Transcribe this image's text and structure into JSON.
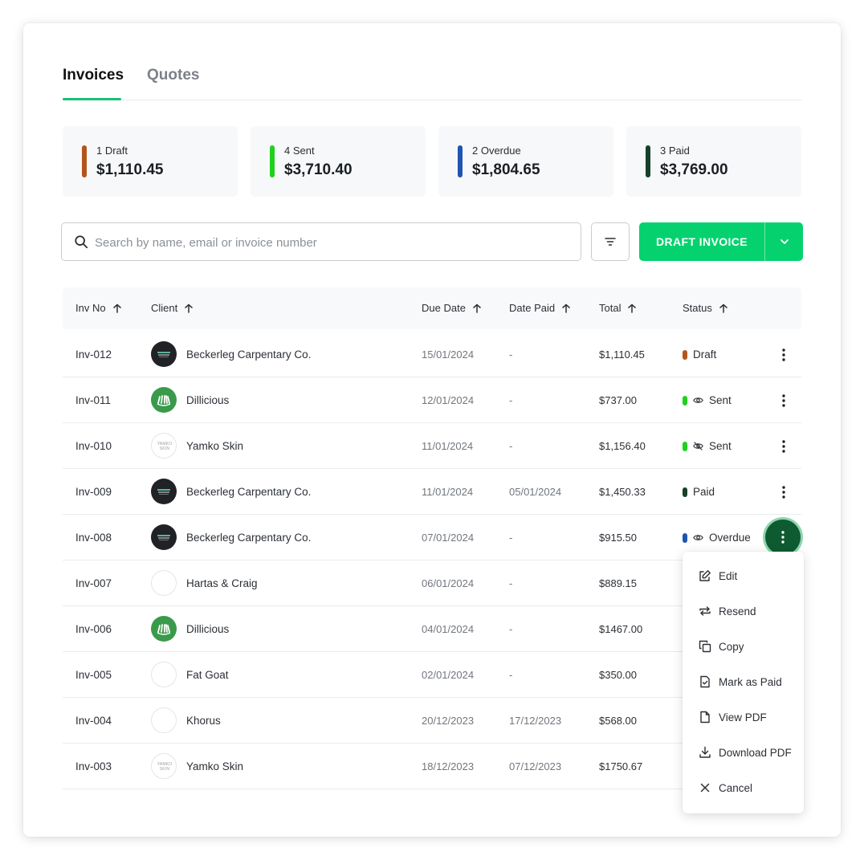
{
  "tabs": [
    {
      "label": "Invoices",
      "active": true
    },
    {
      "label": "Quotes",
      "active": false
    }
  ],
  "summary": [
    {
      "label": "1 Draft",
      "amount": "$1,110.45",
      "color": "#b4541a"
    },
    {
      "label": "4 Sent",
      "amount": "$3,710.40",
      "color": "#1ed11e"
    },
    {
      "label": "2 Overdue",
      "amount": "$1,804.65",
      "color": "#1f54b3"
    },
    {
      "label": "3 Paid",
      "amount": "$3,769.00",
      "color": "#15412a"
    }
  ],
  "search": {
    "placeholder": "Search by name, email or invoice number",
    "icon": "search-icon"
  },
  "toolbar": {
    "filter_icon": "filter-icon",
    "draft_label": "DRAFT INVOICE",
    "accent": "#05d26e"
  },
  "table": {
    "headers": [
      "Inv No",
      "Client",
      "Due Date",
      "Date Paid",
      "Total",
      "Status"
    ],
    "rows": [
      {
        "inv": "Inv-012",
        "client": "Beckerleg Carpentary Co.",
        "logo": "dark",
        "due": "15/01/2024",
        "paid": "-",
        "total": "$1,110.45",
        "status": "Draft",
        "status_color": "#b4541a",
        "status_icon": ""
      },
      {
        "inv": "Inv-011",
        "client": "Dillicious",
        "logo": "green",
        "due": "12/01/2024",
        "paid": "-",
        "total": "$737.00",
        "status": "Sent",
        "status_color": "#1ed11e",
        "status_icon": "eye-icon"
      },
      {
        "inv": "Inv-010",
        "client": "Yamko Skin",
        "logo": "light",
        "logo_text": "YAMKO SKIN",
        "due": "11/01/2024",
        "paid": "-",
        "total": "$1,156.40",
        "status": "Sent",
        "status_color": "#1ed11e",
        "status_icon": "eye-off-icon"
      },
      {
        "inv": "Inv-009",
        "client": "Beckerleg Carpentary Co.",
        "logo": "dark",
        "due": "11/01/2024",
        "paid": "05/01/2024",
        "total": "$1,450.33",
        "status": "Paid",
        "status_color": "#15412a",
        "status_icon": ""
      },
      {
        "inv": "Inv-008",
        "client": "Beckerleg Carpentary Co.",
        "logo": "dark",
        "due": "07/01/2024",
        "paid": "-",
        "total": "$915.50",
        "status": "Overdue",
        "status_color": "#1f54b3",
        "status_icon": "eye-icon"
      },
      {
        "inv": "Inv-007",
        "client": "Hartas & Craig",
        "logo": "light",
        "logo_text": "",
        "due": "06/01/2024",
        "paid": "-",
        "total": "$889.15",
        "status": "",
        "status_color": "",
        "status_icon": ""
      },
      {
        "inv": "Inv-006",
        "client": "Dillicious",
        "logo": "green",
        "due": "04/01/2024",
        "paid": "-",
        "total": "$1467.00",
        "status": "",
        "status_color": "",
        "status_icon": ""
      },
      {
        "inv": "Inv-005",
        "client": "Fat Goat",
        "logo": "light",
        "logo_text": "",
        "due": "02/01/2024",
        "paid": "-",
        "total": "$350.00",
        "status": "",
        "status_color": "",
        "status_icon": ""
      },
      {
        "inv": "Inv-004",
        "client": "Khorus",
        "logo": "light",
        "logo_text": "",
        "due": "20/12/2023",
        "paid": "17/12/2023",
        "total": "$568.00",
        "status": "",
        "status_color": "",
        "status_icon": ""
      },
      {
        "inv": "Inv-003",
        "client": "Yamko Skin",
        "logo": "light",
        "logo_text": "YAMKO SKIN",
        "due": "18/12/2023",
        "paid": "07/12/2023",
        "total": "$1750.67",
        "status": "",
        "status_color": "",
        "status_icon": ""
      }
    ]
  },
  "menu": {
    "items": [
      {
        "label": "Edit",
        "icon": "edit-icon"
      },
      {
        "label": "Resend",
        "icon": "resend-icon"
      },
      {
        "label": "Copy",
        "icon": "copy-icon"
      },
      {
        "label": "Mark as Paid",
        "icon": "mark-paid-icon"
      },
      {
        "label": "View PDF",
        "icon": "file-icon"
      },
      {
        "label": "Download PDF",
        "icon": "download-icon"
      },
      {
        "label": "Cancel",
        "icon": "close-icon"
      }
    ]
  }
}
